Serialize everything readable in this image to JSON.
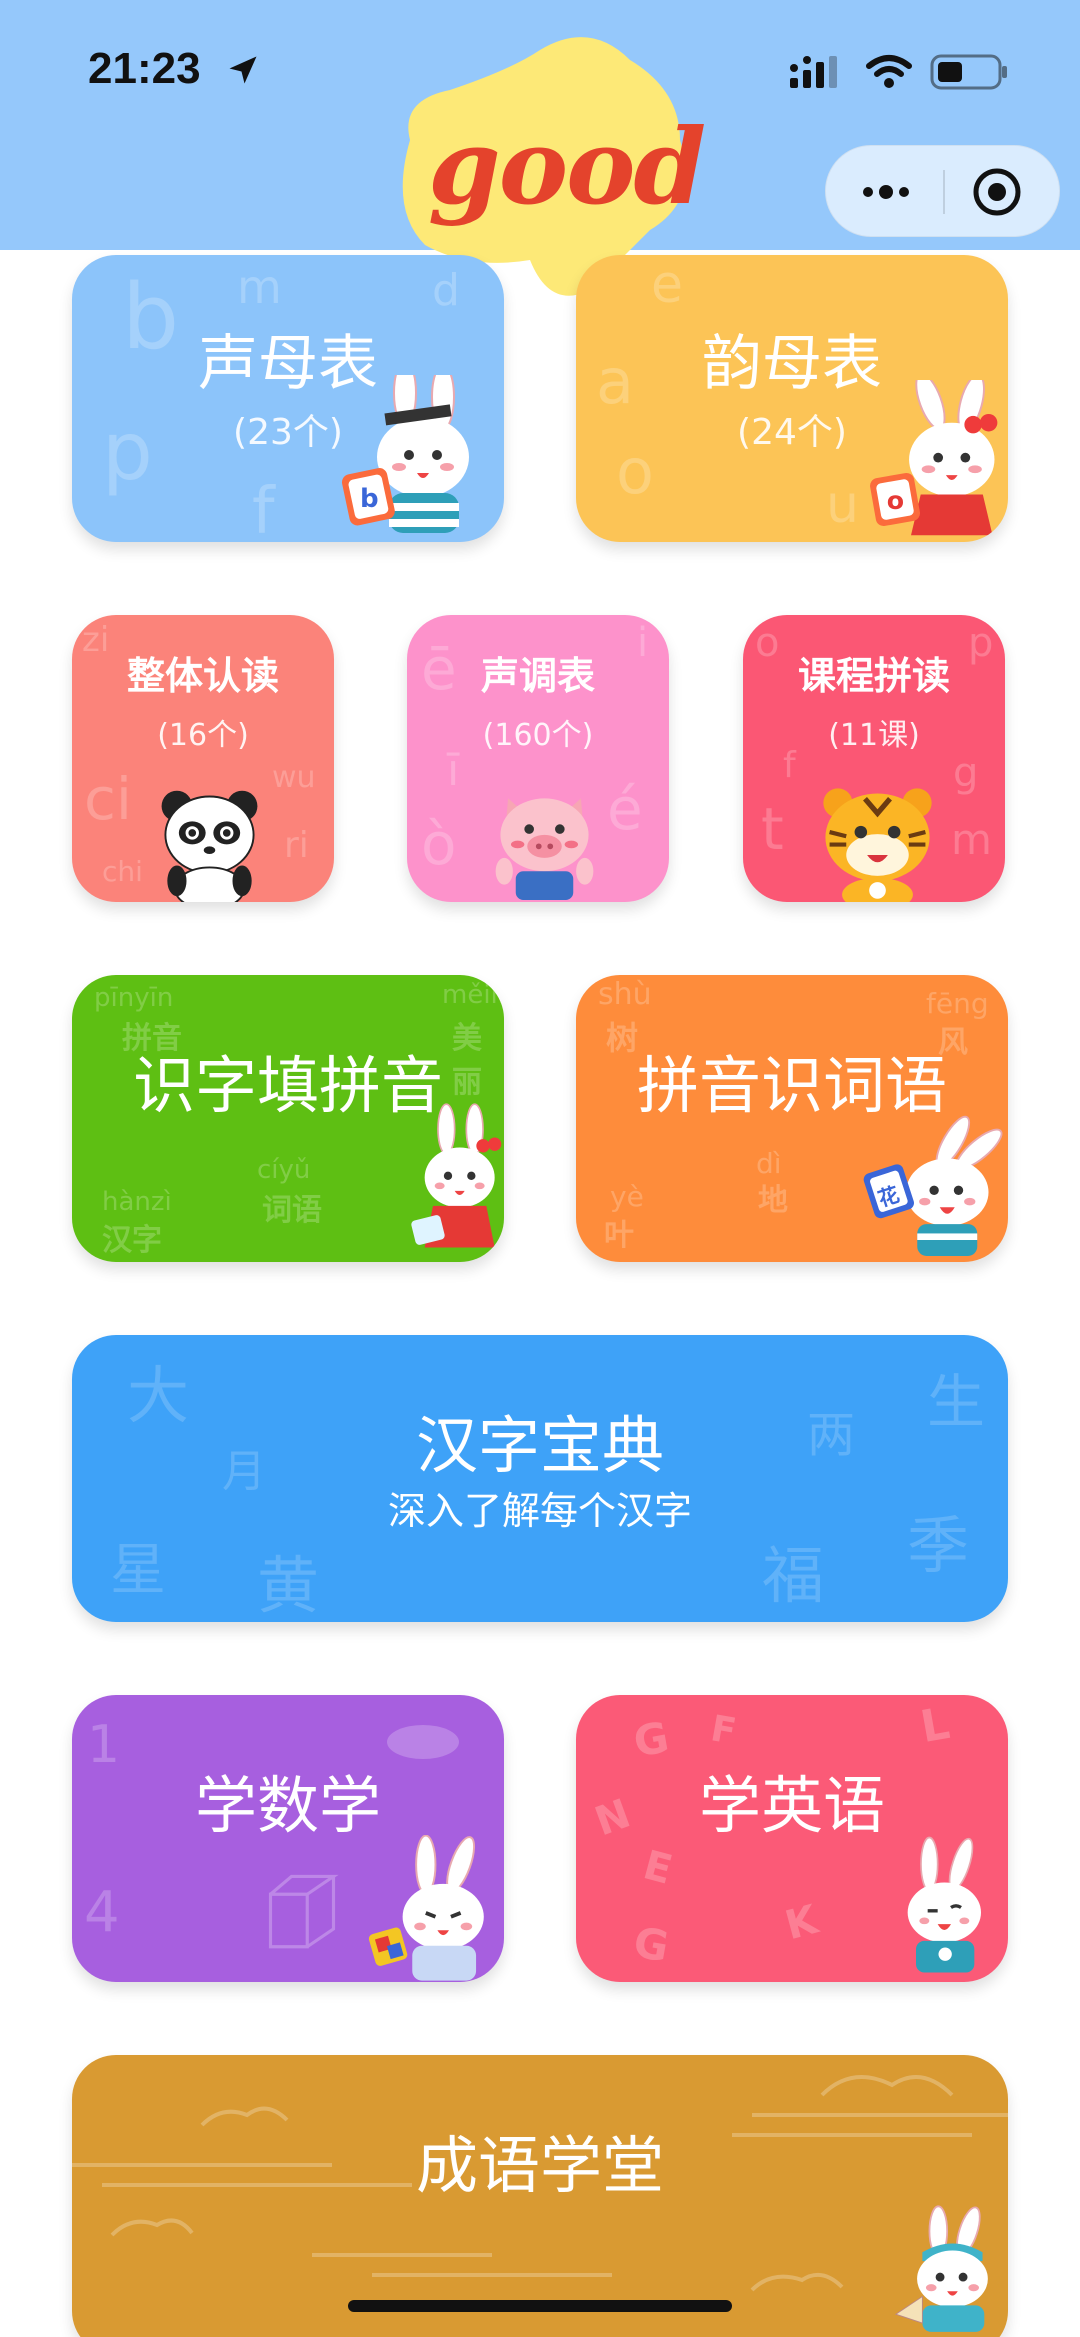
{
  "status_bar": {
    "time": "21:23"
  },
  "header": {
    "logo_text": "good"
  },
  "cards": {
    "initials": {
      "title": "声母表",
      "count": "(23个)"
    },
    "finals": {
      "title": "韵母表",
      "count": "(24个)"
    },
    "whole_reading": {
      "title": "整体认读",
      "count": "(16个)"
    },
    "tones": {
      "title": "声调表",
      "count": "(160个)"
    },
    "course_reading": {
      "title": "课程拼读",
      "count": "(11课)"
    },
    "fill_pinyin": {
      "title": "识字填拼音"
    },
    "pinyin_words": {
      "title": "拼音识词语"
    },
    "dictionary": {
      "title": "汉字宝典",
      "subtitle": "深入了解每个汉字"
    },
    "math": {
      "title": "学数学"
    },
    "english": {
      "title": "学英语"
    },
    "idioms": {
      "title": "成语学堂"
    }
  },
  "decor": {
    "initials": [
      "b",
      "m",
      "d",
      "p",
      "f"
    ],
    "finals": [
      "e",
      "a",
      "o",
      "u"
    ],
    "whole_reading": [
      "zi",
      "ci",
      "chi",
      "wu",
      "ri"
    ],
    "tones": [
      "ē",
      "i",
      "ī",
      "ò",
      "é"
    ],
    "course_reading": [
      "o",
      "p",
      "f",
      "t",
      "g",
      "m"
    ],
    "fill_pinyin": [
      "pīnyīn",
      "拼音",
      "měilì",
      "美丽",
      "cíyǔ",
      "词语",
      "hànzì",
      "汉字"
    ],
    "pinyin_words": [
      "shù",
      "树",
      "fēng",
      "风",
      "dì",
      "地",
      "yè",
      "叶"
    ],
    "dictionary": [
      "大",
      "月",
      "星",
      "黄",
      "两",
      "生",
      "福",
      "季"
    ],
    "math": [
      "1",
      "4"
    ],
    "english": [
      "G",
      "F",
      "L",
      "N",
      "E",
      "K",
      "G"
    ],
    "badges": {
      "initials": "b",
      "finals": "o",
      "pinyin_words": "花"
    }
  },
  "colors": {
    "header_bg": "#95c8fb",
    "initials": "#8cc4fa",
    "finals": "#fcc456",
    "whole_reading": "#fb837a",
    "tones": "#fd92cb",
    "course_reading": "#fb5774",
    "fill_pinyin": "#5ebf13",
    "pinyin_words": "#fe8c3b",
    "dictionary": "#3ea2f8",
    "math": "#a75fdf",
    "english": "#fb5a77",
    "idioms": "#d99a32"
  },
  "icons": [
    "location-arrow-icon",
    "signal-icon",
    "wifi-icon",
    "battery-icon",
    "more-dots-icon",
    "target-icon",
    "bunny-mascot",
    "panda-mascot",
    "pig-mascot",
    "tiger-mascot"
  ]
}
